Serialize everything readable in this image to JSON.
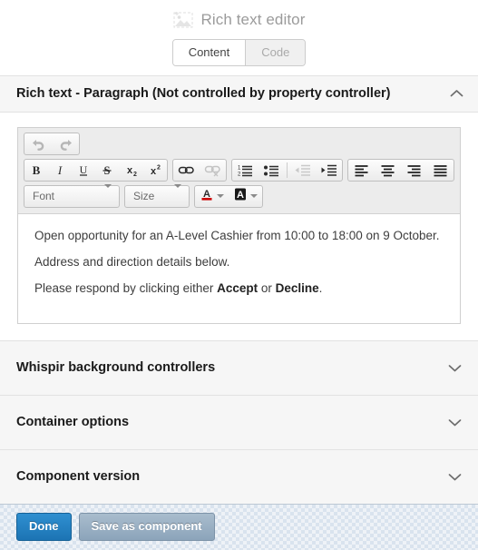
{
  "window": {
    "title": "Rich text editor",
    "title_icon": "broken-image-icon"
  },
  "tabs": [
    {
      "label": "Content",
      "active": true
    },
    {
      "label": "Code",
      "active": false
    }
  ],
  "sections": [
    {
      "title": "Rich text - Paragraph (Not controlled by property controller)",
      "expanded": true,
      "chevron": "chevron-up-icon"
    },
    {
      "title": "Whispir background controllers",
      "expanded": false,
      "chevron": "chevron-down-icon"
    },
    {
      "title": "Container options",
      "expanded": false,
      "chevron": "chevron-down-icon"
    },
    {
      "title": "Component version",
      "expanded": false,
      "chevron": "chevron-down-icon"
    }
  ],
  "toolbar": {
    "history": [
      {
        "name": "undo-icon",
        "title": "Undo",
        "disabled": true
      },
      {
        "name": "redo-icon",
        "title": "Redo",
        "disabled": true
      }
    ],
    "formatting": [
      {
        "name": "bold-icon",
        "title": "Bold",
        "glyph": "B"
      },
      {
        "name": "italic-icon",
        "title": "Italic",
        "glyph": "I"
      },
      {
        "name": "underline-icon",
        "title": "Underline",
        "glyph": "U"
      },
      {
        "name": "strikethrough-icon",
        "title": "Strike Through",
        "glyph": "S"
      },
      {
        "name": "subscript-icon",
        "title": "Subscript",
        "glyph": "x₂"
      },
      {
        "name": "superscript-icon",
        "title": "Superscript",
        "glyph": "x²"
      }
    ],
    "links": [
      {
        "name": "link-icon",
        "title": "Link",
        "disabled": false
      },
      {
        "name": "unlink-icon",
        "title": "Unlink",
        "disabled": true
      }
    ],
    "lists": [
      {
        "name": "numbered-list-icon",
        "title": "Insert/Remove Numbered List",
        "disabled": false
      },
      {
        "name": "bulleted-list-icon",
        "title": "Insert/Remove Bulleted List",
        "disabled": false
      },
      {
        "name": "outdent-icon",
        "title": "Decrease Indent",
        "disabled": true
      },
      {
        "name": "indent-icon",
        "title": "Increase Indent",
        "disabled": false
      }
    ],
    "alignment": [
      {
        "name": "align-left-icon",
        "title": "Align Left"
      },
      {
        "name": "align-center-icon",
        "title": "Center"
      },
      {
        "name": "align-right-icon",
        "title": "Align Right"
      },
      {
        "name": "align-justify-icon",
        "title": "Justify"
      }
    ],
    "font_select": {
      "label": "Font",
      "caret": "caret-down-icon"
    },
    "size_select": {
      "label": "Size",
      "caret": "caret-down-icon"
    },
    "text_color": {
      "name": "text-color-icon",
      "glyph": "A",
      "swatch": "#cc0000",
      "caret": "caret-down-icon"
    },
    "background_color": {
      "name": "background-color-icon",
      "glyph": "A",
      "swatch": "#1a1a1a",
      "caret": "caret-down-icon"
    }
  },
  "editor": {
    "paragraphs": [
      {
        "parts": [
          {
            "text": "Open opportunity for an A-Level Cashier from 10:00 to 18:00 on 9 October.",
            "bold": false
          }
        ]
      },
      {
        "parts": [
          {
            "text": "Address and direction details below.",
            "bold": false
          }
        ]
      },
      {
        "parts": [
          {
            "text": "Please respond by clicking either ",
            "bold": false
          },
          {
            "text": "Accept",
            "bold": true
          },
          {
            "text": " or ",
            "bold": false
          },
          {
            "text": "Decline",
            "bold": true
          },
          {
            "text": ".",
            "bold": false
          }
        ]
      }
    ],
    "line1": "Open opportunity for an A-Level Cashier from 10:00 to 18:00 on 9 October.",
    "line2": "Address and direction details below.",
    "line3_prefix": "Please respond by clicking either ",
    "line3_bold1": "Accept",
    "line3_middle": " or ",
    "line3_bold2": "Decline",
    "line3_suffix": "."
  },
  "footer": {
    "done_label": "Done",
    "save_as_component_label": "Save as component"
  },
  "colors": {
    "primary_button": "#1c74b4",
    "secondary_button": "#8ca4ba",
    "footer_background": "#d9e3ee",
    "section_background": "#f6f6f6",
    "toolbar_background": "#ececec"
  }
}
